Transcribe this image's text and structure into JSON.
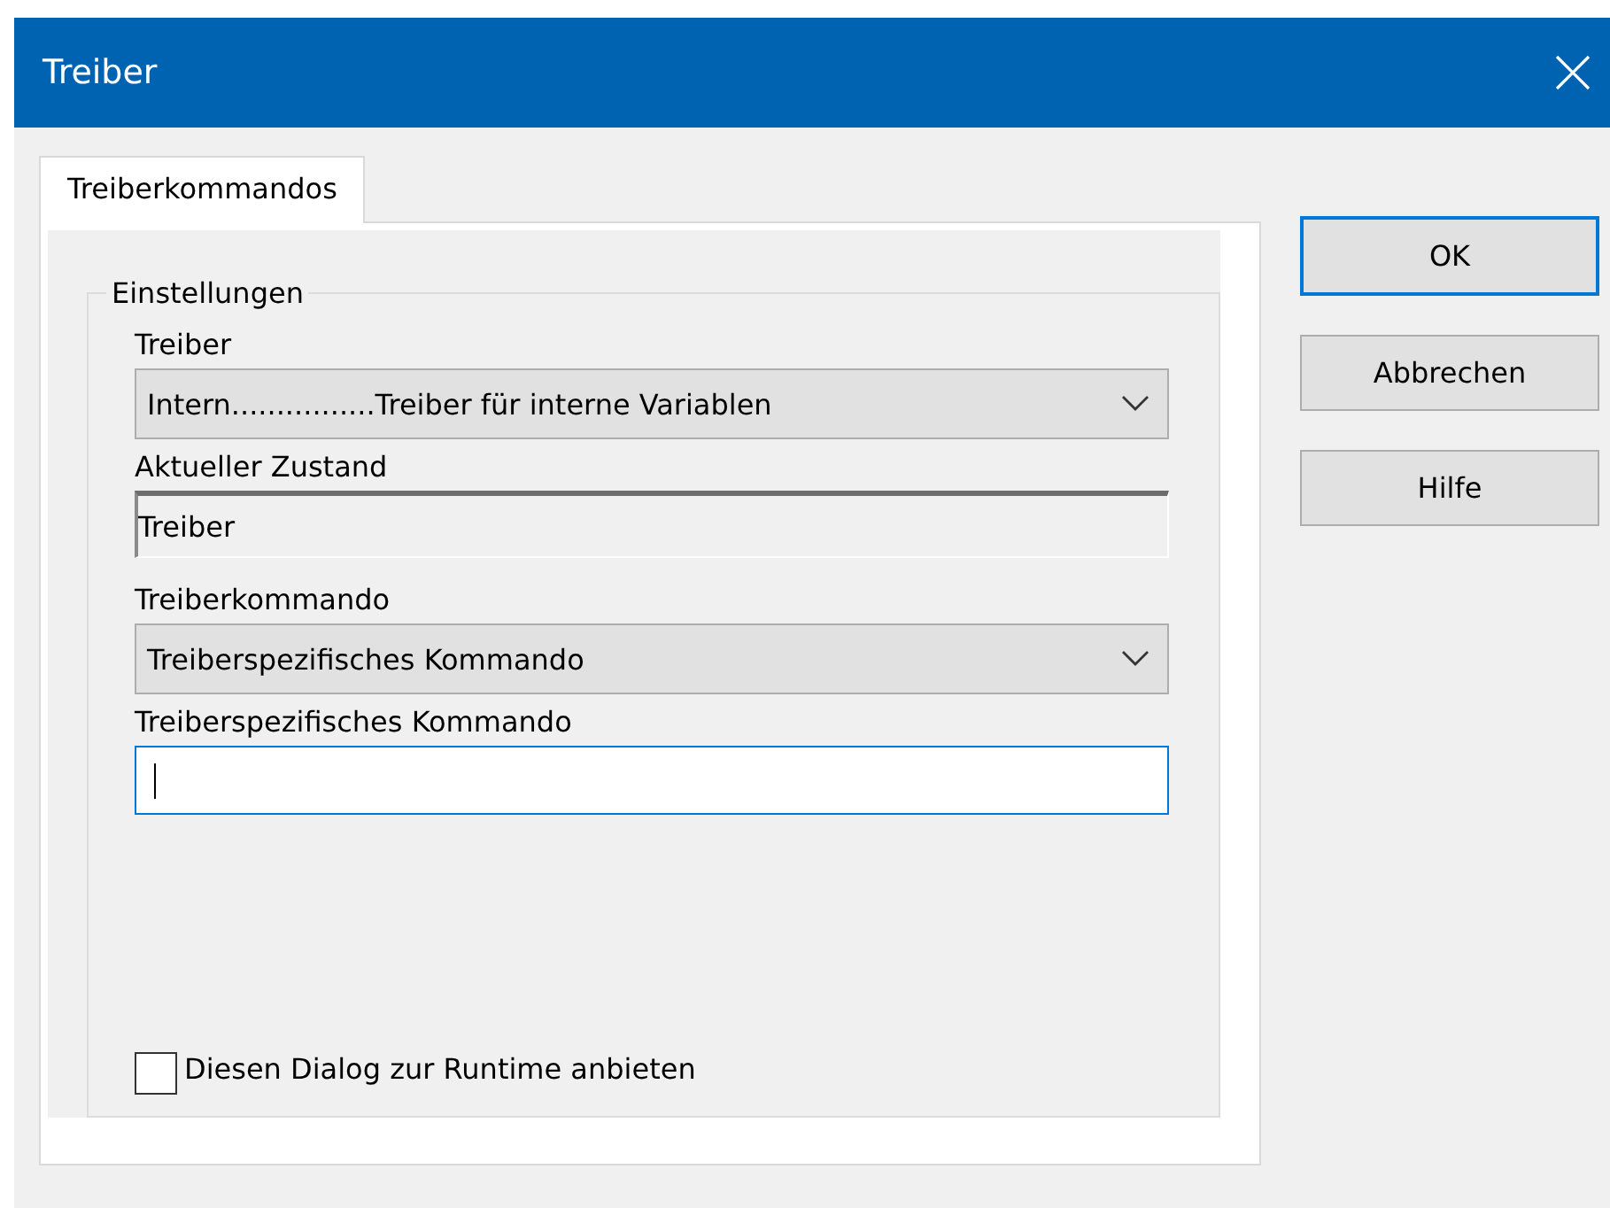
{
  "window": {
    "title": "Treiber"
  },
  "tabs": [
    {
      "label": "Treiberkommandos",
      "selected": true
    }
  ],
  "group": {
    "title": "Einstellungen",
    "fields": [
      {
        "label": "Treiber",
        "kind": "combo",
        "value": "Intern................Treiber für interne Variablen"
      },
      {
        "label": "Aktueller Zustand",
        "kind": "readonly",
        "value": "Treiber"
      },
      {
        "label": "Treiberkommando",
        "kind": "combo",
        "value": "Treiberspezifisches Kommando"
      },
      {
        "label": "Treiberspezifisches Kommando",
        "kind": "input",
        "focused": true
      }
    ],
    "checkbox": {
      "label": "Diesen Dialog zur Runtime anbieten",
      "checked": false
    }
  },
  "buttons": [
    {
      "label": "OK",
      "default": true
    },
    {
      "label": "Abbrechen",
      "default": false
    },
    {
      "label": "Hilfe",
      "default": false
    }
  ]
}
